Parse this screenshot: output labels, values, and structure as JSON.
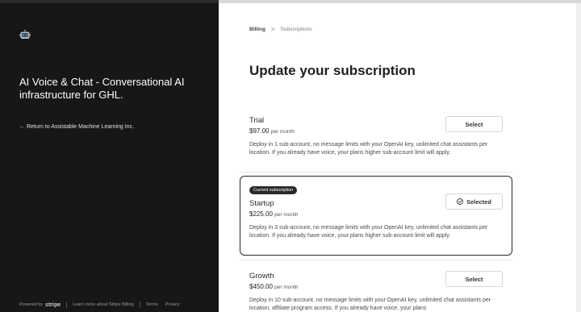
{
  "left": {
    "logo_icon": "robot-icon",
    "title": "AI Voice & Chat - Conversational AI infrastructure for GHL.",
    "back_link": "← Return to Assistable Machine Learning Inc.",
    "footer": {
      "powered_by": "Powered by",
      "brand": "stripe",
      "learn_more": "Learn more about Stripe Billing",
      "terms": "Terms",
      "privacy": "Privacy"
    }
  },
  "breadcrumb": {
    "billing": "Billing",
    "separator": ">",
    "subscriptions": "Subscriptions"
  },
  "heading": "Update your subscription",
  "plans": [
    {
      "name": "Trial",
      "price": "$97.00",
      "per": "per month",
      "description": "Deploy in 1 sub-account, no message limits with your OpenAI key, unlimited chat assistants per location. If you already have voice, your plans higher sub-account limit will apply.",
      "button": "Select"
    },
    {
      "badge": "Current subscription",
      "name": "Startup",
      "price": "$225.00",
      "per": "per month",
      "description": "Deploy in 3 sub-account, no message limits with your OpenAI key, unlimited chat assistants per location. If you already have voice, your plans higher sub-account limit will apply.",
      "button": "Selected"
    },
    {
      "name": "Growth",
      "price": "$450.00",
      "per": "per month",
      "description": "Deploy in 10 sub-account, no message limits with your OpenAI key, unlimited chat assistants per location, affiliate program access. If you already have voice, your plans",
      "button": "Select"
    }
  ]
}
